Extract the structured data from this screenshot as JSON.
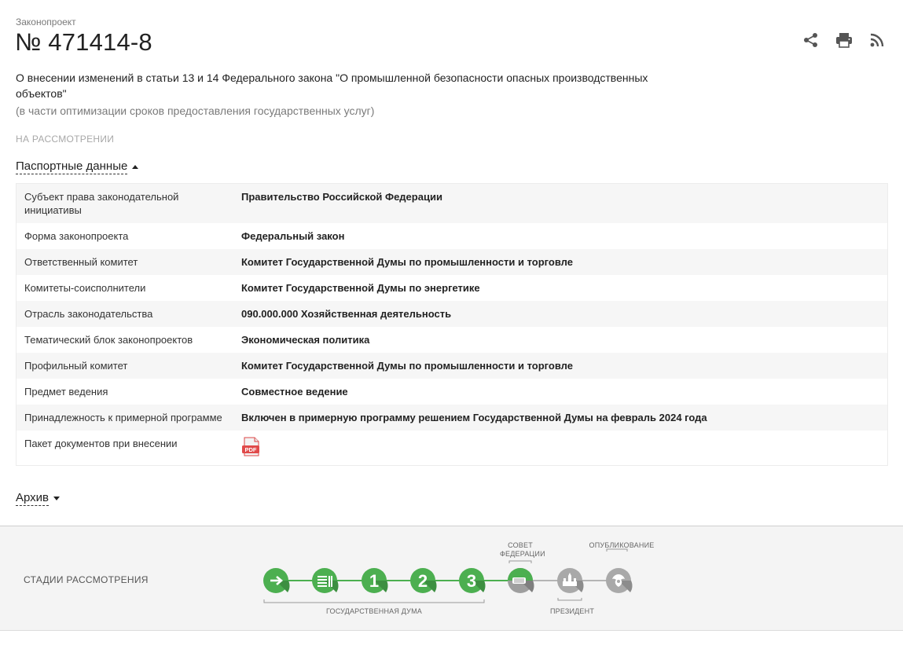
{
  "header": {
    "eyebrow": "Законопроект",
    "number": "№ 471414-8",
    "title": "О внесении изменений в статьи 13 и 14 Федерального закона \"О промышленной безопасности опасных производственных объектов\"",
    "subtitle": "(в части оптимизации сроков предоставления государственных услуг)",
    "status": "НА РАССМОТРЕНИИ",
    "actions": [
      {
        "icon": "share-icon"
      },
      {
        "icon": "print-icon"
      },
      {
        "icon": "rss-icon"
      }
    ]
  },
  "passport": {
    "toggle_label": "Паспортные данные",
    "rows": [
      {
        "key": "Субъект права законодательной инициативы",
        "value": "Правительство Российской Федерации"
      },
      {
        "key": "Форма законопроекта",
        "value": "Федеральный закон"
      },
      {
        "key": "Ответственный комитет",
        "value": "Комитет Государственной Думы по промышленности и торговле"
      },
      {
        "key": "Комитеты-соисполнители",
        "value": "Комитет Государственной Думы по энергетике"
      },
      {
        "key": "Отрасль законодательства",
        "value": "090.000.000 Хозяйственная деятельность"
      },
      {
        "key": "Тематический блок законопроектов",
        "value": "Экономическая политика"
      },
      {
        "key": "Профильный комитет",
        "value": "Комитет Государственной Думы по промышленности и торговле"
      },
      {
        "key": "Предмет ведения",
        "value": "Совместное ведение"
      },
      {
        "key": "Принадлежность к примерной программе",
        "value": "Включен в примерную программу решением Государственной Думы на февраль 2024 года"
      }
    ],
    "package_row": {
      "key": "Пакет документов при внесении",
      "file_label": "PDF",
      "file_icon": "pdf-file-icon"
    }
  },
  "archive": {
    "toggle_label": "Архив"
  },
  "stages": {
    "label": "СТАДИИ РАССМОТРЕНИЯ",
    "gd_label": "ГОСУДАРСТВЕННАЯ ДУМА",
    "sf_label_1": "СОВЕТ",
    "sf_label_2": "ФЕДЕРАЦИИ",
    "president_label": "ПРЕЗИДЕНТ",
    "publication_label": "ОПУБЛИКОВАНИЕ",
    "readings": [
      "1",
      "2",
      "3"
    ],
    "completed_color": "#4caf50",
    "inactive_color": "#a9a9a9",
    "steps": [
      {
        "icon": "arrow-right-icon",
        "state": "done"
      },
      {
        "icon": "document-list-icon",
        "state": "done"
      },
      {
        "icon": "reading-1-icon",
        "state": "done"
      },
      {
        "icon": "reading-2-icon",
        "state": "done"
      },
      {
        "icon": "reading-3-icon",
        "state": "done"
      },
      {
        "icon": "federation-council-icon",
        "state": "current"
      },
      {
        "icon": "kremlin-icon",
        "state": "pending"
      },
      {
        "icon": "eagle-emblem-icon",
        "state": "pending"
      }
    ]
  }
}
